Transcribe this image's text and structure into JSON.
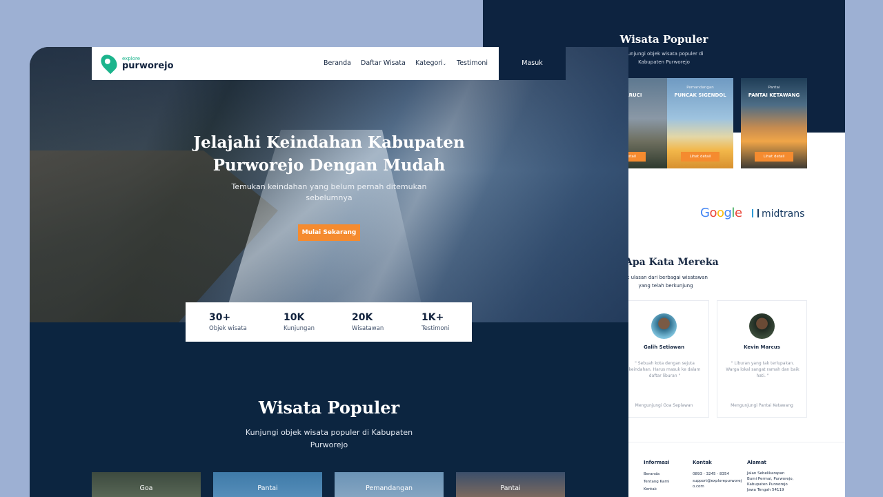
{
  "back": {
    "popular": {
      "title": "Wisata Populer",
      "subtitle": "Kunjungi objek wisata populer di Kabupaten Purworejo",
      "cards": [
        {
          "category": "",
          "name": "EWARUCI",
          "button": "etail"
        },
        {
          "category": "Pemandangan",
          "name": "PUNCAK SIGENDOL",
          "button": "Lihat detail"
        },
        {
          "category": "Pantai",
          "name": "PANTAI KETAWANG",
          "button": "Lihat detail"
        }
      ]
    },
    "partners": {
      "google": "Google",
      "midtrans": "midtrans"
    },
    "testimonials": {
      "title": "Apa Kata Mereka",
      "subtitle": "ak ulasan dari berbagai wisatawan yang telah berkunjung",
      "items": [
        {
          "name": "Galih Setiawan",
          "quote": "\" Sebuah kota dengan sejuta keindahan. Harus masuk ke dalam daftar liburan \"",
          "visited": "Mengunjungi Goa Seplawan"
        },
        {
          "name": "Kevin Marcus",
          "quote": "\" Liburan yang tak terlupakan. Warga lokal sangat ramah dan baik hati. \"",
          "visited": "Mengunjungi Pantai Ketawang"
        }
      ]
    },
    "footer": {
      "info": {
        "heading": "Informasi",
        "links": [
          "Beranda",
          "Tentang Kami",
          "Kontak"
        ]
      },
      "contact": {
        "heading": "Kontak",
        "phone": "0893 - 3245 - 8354",
        "email": "support@explorepurworejo.com"
      },
      "address": {
        "heading": "Alamat",
        "lines": [
          "Jalan Sebelikarapan",
          "Bumi Permai, Purworejo,",
          "Kabupaten Purworejo",
          "Jawa Tengah 54119"
        ]
      }
    }
  },
  "front": {
    "logo": {
      "small": "explore",
      "big": "purworejo"
    },
    "nav": {
      "items": [
        "Beranda",
        "Daftar Wisata",
        "Kategori",
        "Testimoni"
      ],
      "login": "Masuk"
    },
    "hero": {
      "title": "Jelajahi Keindahan Kabupaten Purworejo Dengan Mudah",
      "subtitle": "Temukan keindahan yang belum pernah ditemukan sebelumnya",
      "cta": "Mulai Sekarang"
    },
    "stats": [
      {
        "value": "30+",
        "label": "Objek wisata"
      },
      {
        "value": "10K",
        "label": "Kunjungan"
      },
      {
        "value": "20K",
        "label": "Wisatawan"
      },
      {
        "value": "1K+",
        "label": "Testimoni"
      }
    ],
    "popular": {
      "title": "Wisata Populer",
      "subtitle": "Kunjungi objek wisata populer di Kabupaten Purworejo",
      "cards": [
        "Goa",
        "Pantai",
        "Pemandangan",
        "Pantai"
      ]
    }
  },
  "colors": {
    "navy": "#0d2340",
    "accent": "#f58b2f",
    "brand": "#1cb48c",
    "background": "#9db0d3"
  }
}
